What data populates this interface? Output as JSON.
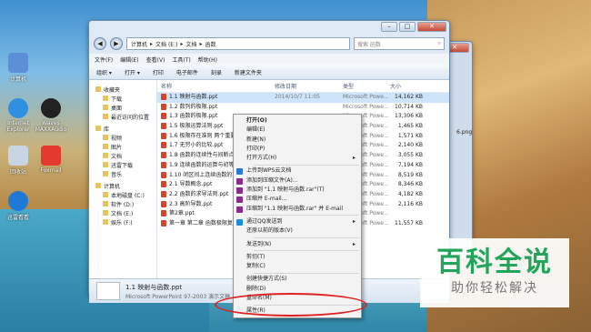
{
  "desktop": {
    "icons": [
      {
        "label": "计算机",
        "color": "#5d8fd6"
      },
      {
        "label": "Internet Explorer",
        "color": "#2f8fe0"
      },
      {
        "label": "Waves MAXXAudio",
        "color": "#222"
      },
      {
        "label": "回收站",
        "color": "#c8d4e2"
      },
      {
        "label": "Foxmail",
        "color": "#e23a2c"
      },
      {
        "label": "迅雷看看",
        "color": "#1e78d6"
      }
    ],
    "png_label": "6.png"
  },
  "explorer": {
    "breadcrumb": [
      "计算机",
      "文档 (E:)",
      "文档",
      "函数"
    ],
    "search_placeholder": "搜索 函数",
    "menubar": [
      "文件(F)",
      "编辑(E)",
      "查看(V)",
      "工具(T)",
      "帮助(H)"
    ],
    "toolbar": [
      "组织 ▾",
      "打开 ▾",
      "打印",
      "电子邮件",
      "刻录",
      "新建文件夹"
    ],
    "columns": [
      "名称",
      "修改日期",
      "类型",
      "大小"
    ],
    "nav": [
      {
        "label": "收藏夹",
        "head": true
      },
      {
        "label": "下载"
      },
      {
        "label": "桌面"
      },
      {
        "label": "最近访问的位置"
      },
      {
        "label": "库",
        "head": true
      },
      {
        "label": "视频"
      },
      {
        "label": "图片"
      },
      {
        "label": "文档"
      },
      {
        "label": "迅雷下载"
      },
      {
        "label": "音乐"
      },
      {
        "label": "计算机",
        "head": true
      },
      {
        "label": "本地磁盘 (C:)"
      },
      {
        "label": "软件 (D:)"
      },
      {
        "label": "文档 (E:)"
      },
      {
        "label": "娱乐 (F:)"
      }
    ],
    "files": [
      {
        "name": "1.1 映射与函数.ppt",
        "date": "2014/10/7 11:05",
        "type": "Microsoft Powe...",
        "size": "14,162 KB",
        "selected": true
      },
      {
        "name": "1.2 数列的极限.ppt",
        "date": "",
        "type": "Microsoft Powe...",
        "size": "10,714 KB"
      },
      {
        "name": "1.3 函数的极限.ppt",
        "date": "",
        "type": "Microsoft Powe...",
        "size": "13,306 KB"
      },
      {
        "name": "1.5 极限运算法则.ppt",
        "date": "",
        "type": "Microsoft Powe...",
        "size": "1,465 KB"
      },
      {
        "name": "1.6 极限存在准则 两个重要...",
        "date": "",
        "type": "Microsoft Powe...",
        "size": "1,571 KB"
      },
      {
        "name": "1.7 无穷小的比较.ppt",
        "date": "",
        "type": "Microsoft Powe...",
        "size": "2,140 KB"
      },
      {
        "name": "1.8 函数的连续性与间断点...",
        "date": "",
        "type": "Microsoft Powe...",
        "size": "3,055 KB"
      },
      {
        "name": "1.9 连续函数的运算与初等...",
        "date": "",
        "type": "Microsoft Powe...",
        "size": "7,194 KB"
      },
      {
        "name": "1.10 闭区间上连续函数的...",
        "date": "",
        "type": "Microsoft Powe...",
        "size": "8,519 KB"
      },
      {
        "name": "2.1 导数概念.ppt",
        "date": "",
        "type": "Microsoft Powe...",
        "size": "8,346 KB"
      },
      {
        "name": "2.2 函数的求导法则.ppt",
        "date": "",
        "type": "Microsoft Powe...",
        "size": "4,182 KB"
      },
      {
        "name": "2.3 高阶导数.ppt",
        "date": "",
        "type": "Microsoft Powe...",
        "size": "2,116 KB"
      },
      {
        "name": "第2章.ppt",
        "date": "",
        "type": "Microsoft Powe...",
        "size": ""
      },
      {
        "name": "第一章 第二章 函数极限复...",
        "date": "",
        "type": "Microsoft Powe...",
        "size": "11,557 KB"
      }
    ],
    "details": {
      "name": "1.1 映射与函数.ppt",
      "type": "Microsoft PowerPoint 97-2003 演示文稿"
    }
  },
  "context_menu": [
    {
      "label": "打开(O)",
      "bold": true
    },
    {
      "label": "编辑(E)"
    },
    {
      "label": "新建(N)"
    },
    {
      "label": "打印(P)"
    },
    {
      "label": "打开方式(H)",
      "arrow": true
    },
    {
      "sep": true
    },
    {
      "label": "上传到WPS云文档",
      "icon": "#2a78d6"
    },
    {
      "label": "添加到压缩文件(A)...",
      "icon": "#8b2c8b"
    },
    {
      "label": "添加到 \"1.1 映射与函数.rar\"(T)",
      "icon": "#8b2c8b"
    },
    {
      "label": "压缩并 E-mail...",
      "icon": "#8b2c8b"
    },
    {
      "label": "压缩到 \"1.1 映射与函数.rar\" 并 E-mail",
      "icon": "#8b2c8b"
    },
    {
      "sep": true
    },
    {
      "label": "通过QQ发送到",
      "arrow": true,
      "icon": "#1a8fe0"
    },
    {
      "label": "还原以前的版本(V)"
    },
    {
      "sep": true
    },
    {
      "label": "发送到(N)",
      "arrow": true
    },
    {
      "sep": true
    },
    {
      "label": "剪切(T)"
    },
    {
      "label": "复制(C)"
    },
    {
      "sep": true
    },
    {
      "label": "创建快捷方式(S)"
    },
    {
      "label": "删除(D)"
    },
    {
      "label": "重命名(M)"
    },
    {
      "sep": true
    },
    {
      "label": "属性(R)"
    }
  ],
  "watermark": {
    "title": "百科全说",
    "subtitle": "助你轻松解决"
  }
}
